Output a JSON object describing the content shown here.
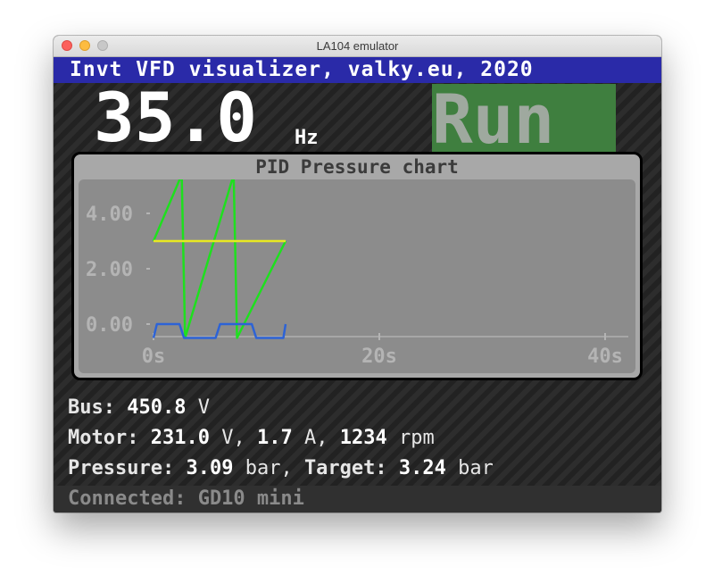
{
  "window": {
    "title": "LA104 emulator"
  },
  "banner": {
    "text": "Invt VFD visualizer, valky.eu, 2020"
  },
  "frequency": {
    "value": "35.0",
    "unit": "Hz"
  },
  "state": {
    "label": "Run",
    "color": "#3f7f3f"
  },
  "info": {
    "bus_label": "Bus:",
    "bus_value": "450.8",
    "bus_unit": "V",
    "motor_label": "Motor:",
    "motor_voltage": "231.0",
    "motor_voltage_unit": "V,",
    "motor_current": "1.7",
    "motor_current_unit": "A,",
    "motor_speed": "1234",
    "motor_speed_unit": "rpm",
    "pressure_label": "Pressure:",
    "pressure_value": "3.09",
    "pressure_unit": "bar,",
    "target_label": "Target:",
    "target_value": "3.24",
    "target_unit": "bar"
  },
  "status": {
    "text": "Connected: GD10 mini",
    "indicator_color": "#18c818"
  },
  "chart_data": {
    "type": "line",
    "title": "PID Pressure chart",
    "x_ticks": [
      "0s",
      "20s",
      "40s"
    ],
    "y_ticks": [
      "0.00",
      "2.00",
      "4.00"
    ],
    "xlim": [
      0,
      40
    ],
    "ylim": [
      -0.5,
      5.4
    ],
    "series": [
      {
        "color": "#1ee01e",
        "x": [
          0,
          2.5,
          2.8,
          7.1,
          7.4,
          11.7
        ],
        "y": [
          3.0,
          5.4,
          -0.5,
          5.4,
          -0.5,
          3.0
        ]
      },
      {
        "color": "#e8e822",
        "x": [
          0,
          11.7
        ],
        "y": [
          3.0,
          3.0
        ]
      },
      {
        "color": "#2d63d6",
        "x": [
          0,
          0.3,
          2.3,
          2.7,
          5.5,
          5.9,
          8.7,
          9.1,
          11.5,
          11.7
        ],
        "y": [
          -0.5,
          0.0,
          0.0,
          -0.5,
          -0.5,
          0.0,
          0.0,
          -0.5,
          -0.5,
          0.0
        ]
      }
    ]
  }
}
